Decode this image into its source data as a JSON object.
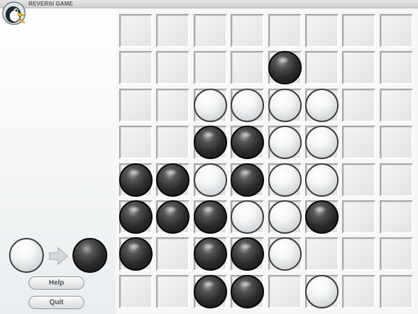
{
  "app": {
    "title": "REVERSI GAME",
    "logo_icon": "penguin-icon"
  },
  "turn_indicator": {
    "from_piece": "white",
    "to_piece": "black",
    "arrow_icon": "arrow-right-icon"
  },
  "buttons": {
    "help_label": "Help",
    "quit_label": "Quit"
  },
  "board": {
    "rows": 8,
    "cols": 8,
    "grid": [
      [
        "",
        "",
        "",
        "",
        "",
        "",
        "",
        ""
      ],
      [
        "",
        "",
        "",
        "",
        "B",
        "",
        "",
        ""
      ],
      [
        "",
        "",
        "W",
        "W",
        "W",
        "W",
        "",
        ""
      ],
      [
        "",
        "",
        "B",
        "B",
        "W",
        "W",
        "",
        ""
      ],
      [
        "B",
        "B",
        "W",
        "B",
        "W",
        "W",
        "",
        ""
      ],
      [
        "B",
        "B",
        "B",
        "W",
        "W",
        "B",
        "",
        ""
      ],
      [
        "B",
        "",
        "B",
        "B",
        "W",
        "",
        "",
        ""
      ],
      [
        "",
        "",
        "B",
        "B",
        "",
        "W",
        "",
        ""
      ]
    ]
  },
  "colors": {
    "board_bg": "#f7f7f7",
    "black_piece": "#1a1a1a",
    "white_piece": "#f4f6f7",
    "arrow": "#c9cdcf"
  }
}
